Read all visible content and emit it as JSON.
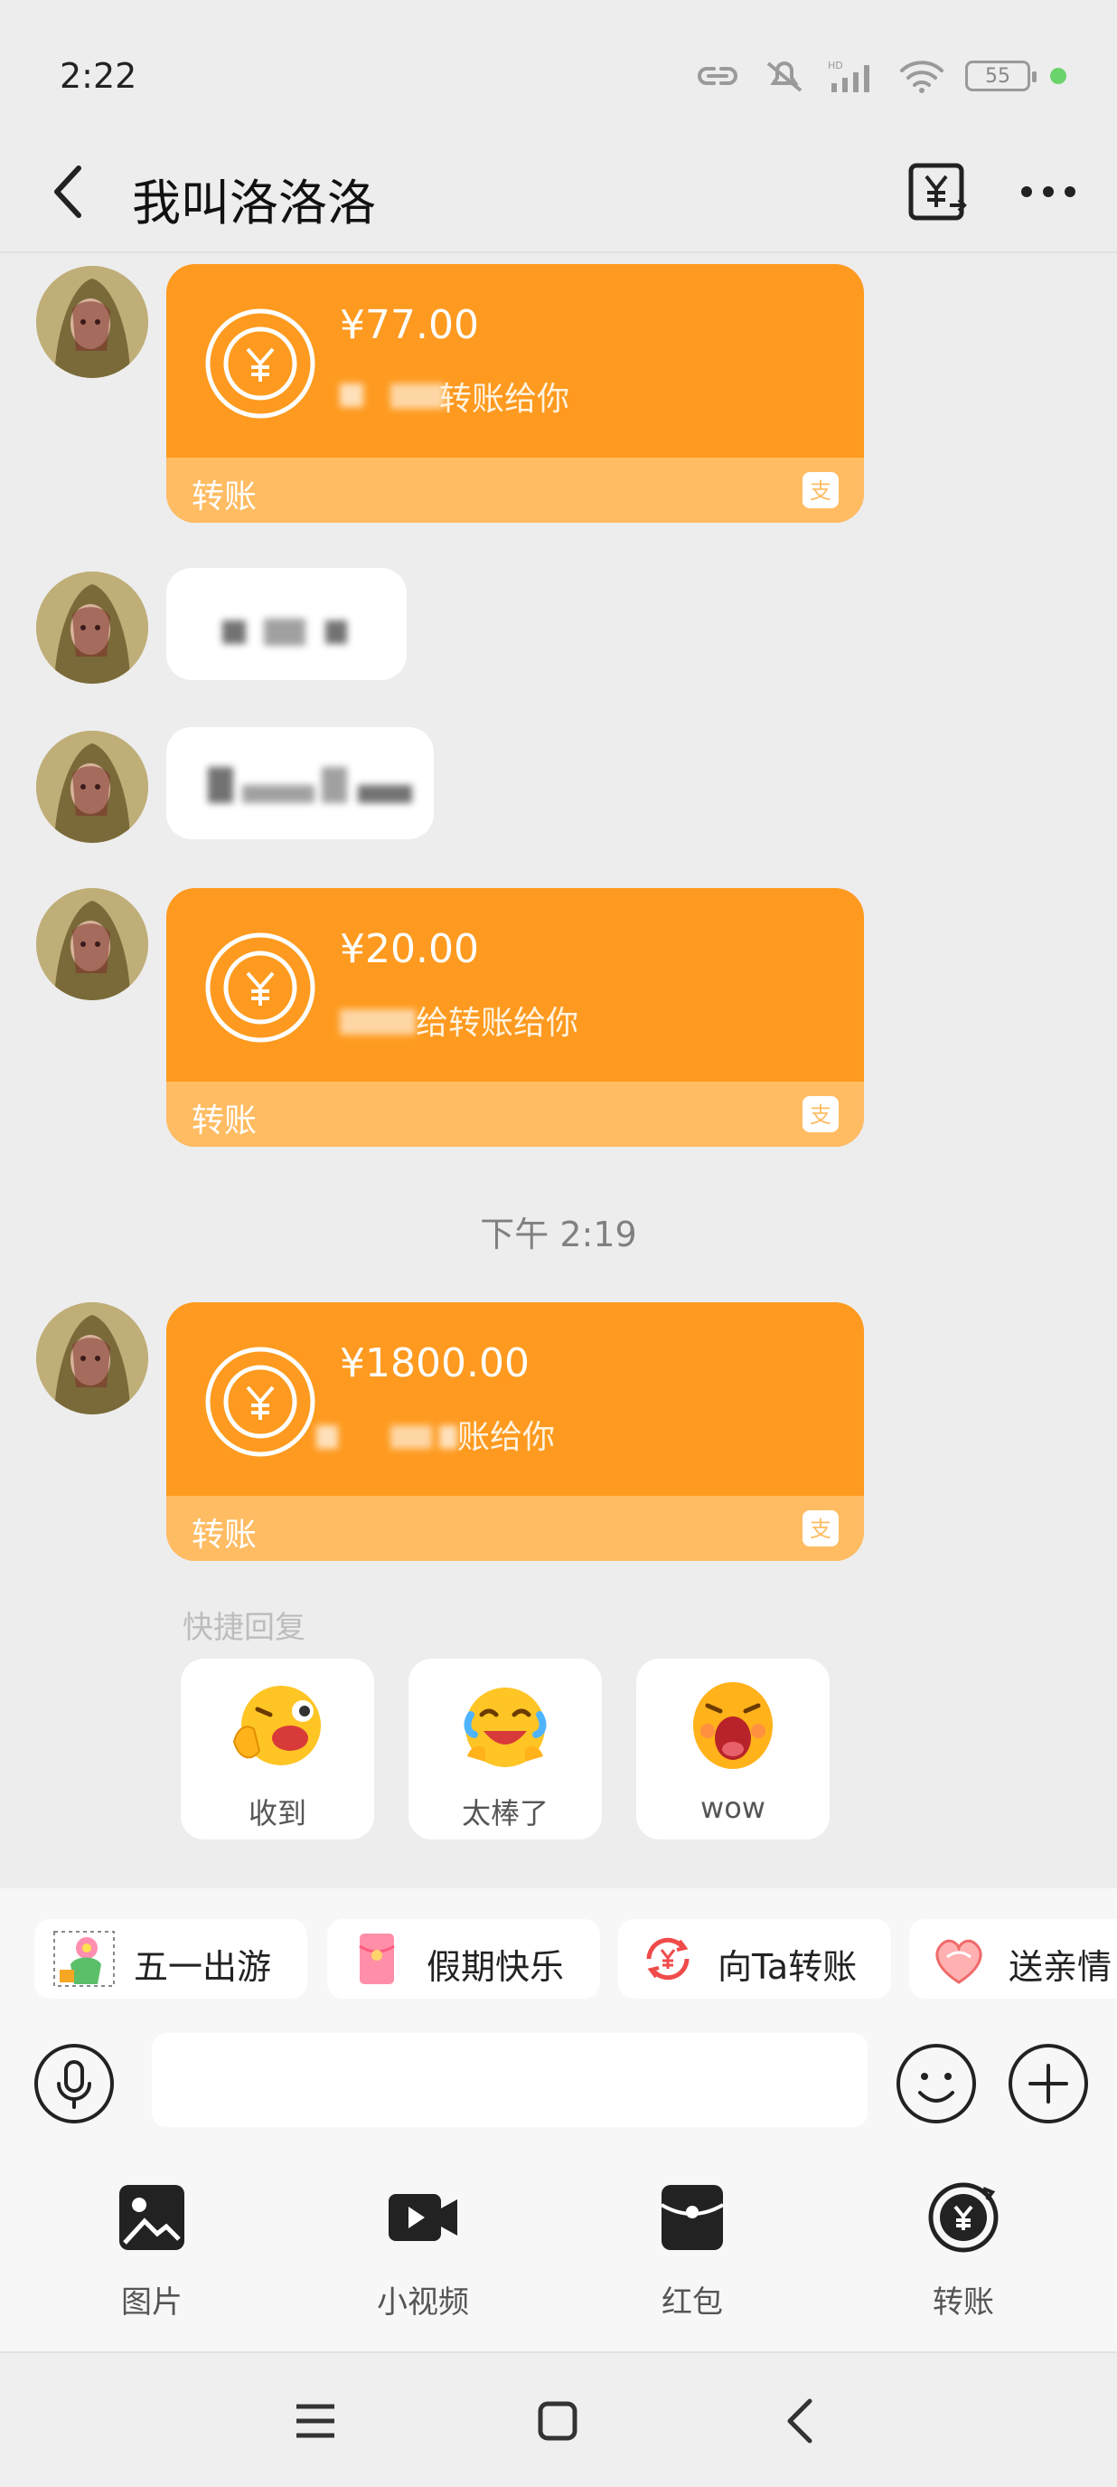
{
  "status_bar": {
    "time": "2:22",
    "battery": "55",
    "network_badge": "HD"
  },
  "header": {
    "title": "我叫洛洛洛"
  },
  "messages": [
    {
      "type": "transfer",
      "amount": "¥77.00",
      "description": "转账给你",
      "footer_label": "转账"
    },
    {
      "type": "text",
      "text": ""
    },
    {
      "type": "text",
      "text": ""
    },
    {
      "type": "transfer",
      "amount": "¥20.00",
      "description": "给转账给你",
      "footer_label": "转账"
    },
    {
      "type": "transfer",
      "amount": "¥1800.00",
      "description": "账给你",
      "footer_label": "转账"
    }
  ],
  "time_divider": "下午 2:19",
  "quick_reply": {
    "label": "快捷回复",
    "items": [
      {
        "text": "收到",
        "icon": "ok-hand-emoji-icon"
      },
      {
        "text": "太棒了",
        "icon": "crying-laugh-emoji-icon"
      },
      {
        "text": "wow",
        "icon": "shout-emoji-icon"
      }
    ]
  },
  "shortcut_chips": [
    {
      "label": "五一出游",
      "icon": "travel-sticker-icon"
    },
    {
      "label": "假期快乐",
      "icon": "red-envelope-icon"
    },
    {
      "label": "向Ta转账",
      "icon": "transfer-icon"
    },
    {
      "label": "送亲情",
      "icon": "heart-gift-icon"
    }
  ],
  "input": {
    "value": "",
    "placeholder": ""
  },
  "tools": [
    {
      "label": "图片",
      "icon": "image-icon"
    },
    {
      "label": "小视频",
      "icon": "video-icon"
    },
    {
      "label": "红包",
      "icon": "red-packet-icon"
    },
    {
      "label": "转账",
      "icon": "transfer-circle-icon"
    }
  ],
  "colors": {
    "card_orange": "#fe9a1f",
    "card_footer": "#ffbc63",
    "background": "#ededed"
  }
}
